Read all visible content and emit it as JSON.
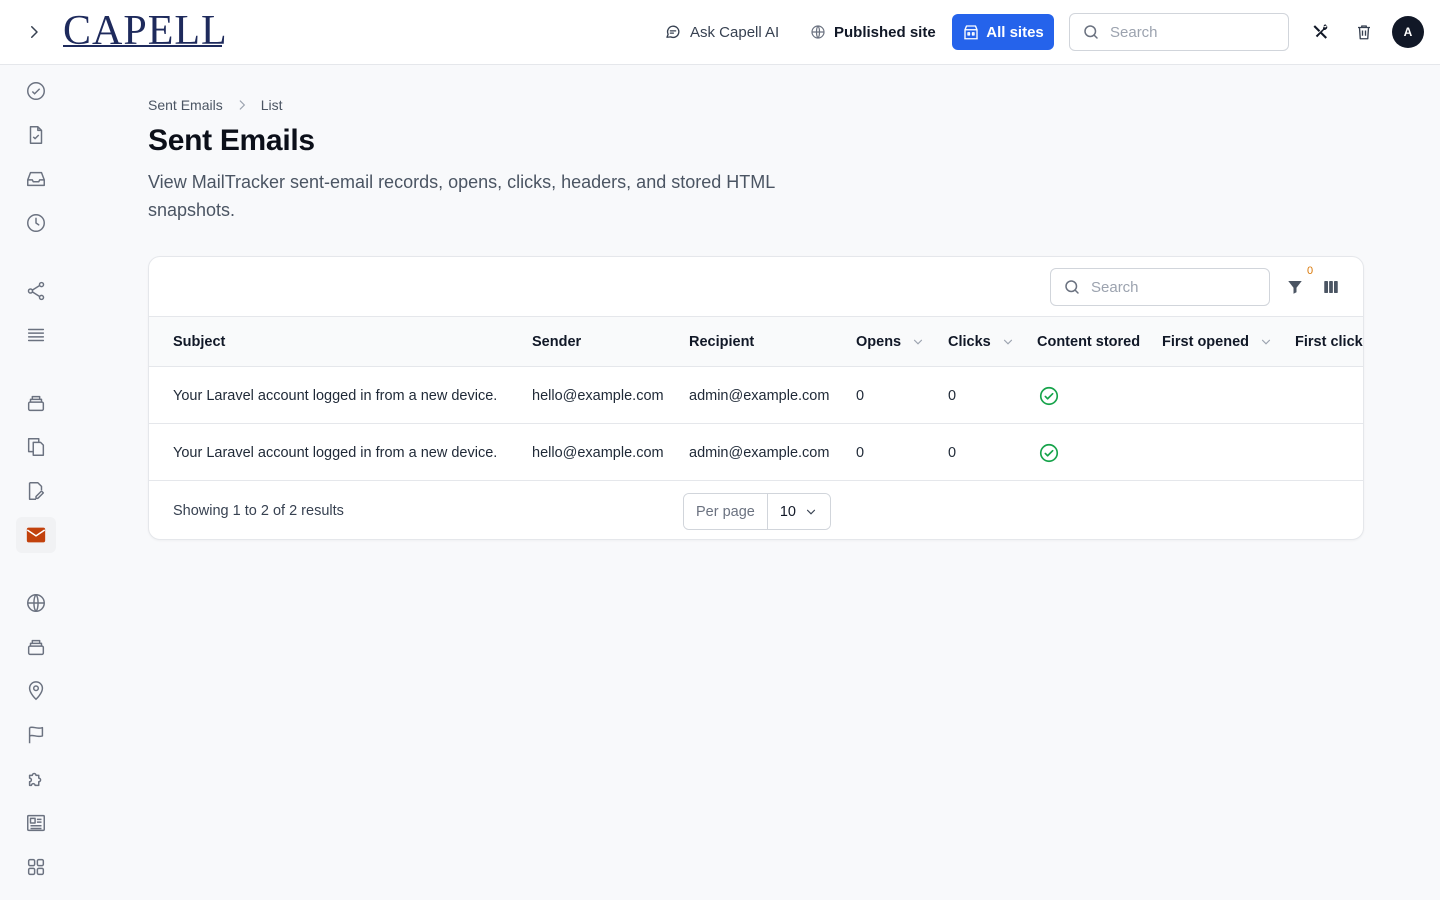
{
  "app": {
    "logo_text": "CAPELL"
  },
  "topbar": {
    "ask_ai_label": "Ask Capell AI",
    "published_site_label": "Published site",
    "all_sites_label": "All sites",
    "search_placeholder": "Search",
    "avatar_initial": "A"
  },
  "sidebar": {
    "items": [
      {
        "icon": "check-circle-icon"
      },
      {
        "icon": "file-check-icon"
      },
      {
        "icon": "inbox-icon"
      },
      {
        "icon": "clock-icon"
      },
      {
        "icon": "share-icon"
      },
      {
        "icon": "list-icon"
      },
      {
        "icon": "stack-icon"
      },
      {
        "icon": "documents-icon"
      },
      {
        "icon": "file-edit-icon"
      },
      {
        "icon": "envelope-icon",
        "active": true
      },
      {
        "icon": "globe-icon"
      },
      {
        "icon": "stack-icon"
      },
      {
        "icon": "map-pin-icon"
      },
      {
        "icon": "flag-icon"
      },
      {
        "icon": "puzzle-icon"
      },
      {
        "icon": "newspaper-icon"
      },
      {
        "icon": "grid-icon"
      }
    ],
    "active_color": "#c2410c"
  },
  "breadcrumb": {
    "parent": "Sent Emails",
    "current": "List"
  },
  "page": {
    "title": "Sent Emails",
    "description": "View MailTracker sent-email records, opens, clicks, headers, and stored HTML snapshots."
  },
  "table": {
    "search_placeholder": "Search",
    "filter_count": "0",
    "columns": [
      {
        "label": "Subject",
        "sortable": false
      },
      {
        "label": "Sender",
        "sortable": false
      },
      {
        "label": "Recipient",
        "sortable": false
      },
      {
        "label": "Opens",
        "sortable": true
      },
      {
        "label": "Clicks",
        "sortable": true
      },
      {
        "label": "Content stored",
        "sortable": false
      },
      {
        "label": "First opened",
        "sortable": true
      },
      {
        "label": "First clicke",
        "sortable": false
      }
    ],
    "rows": [
      {
        "subject": "Your Laravel account logged in from a new device.",
        "sender": "hello@example.com",
        "recipient": "admin@example.com",
        "opens": "0",
        "clicks": "0",
        "content_stored": true
      },
      {
        "subject": "Your Laravel account logged in from a new device.",
        "sender": "hello@example.com",
        "recipient": "admin@example.com",
        "opens": "0",
        "clicks": "0",
        "content_stored": true
      }
    ],
    "footer": {
      "results_text": "Showing 1 to 2 of 2 results",
      "per_page_label": "Per page",
      "per_page_value": "10"
    }
  },
  "colors": {
    "accent": "#2563eb",
    "success": "#16a34a",
    "brand_navy": "#1e2a5c"
  }
}
